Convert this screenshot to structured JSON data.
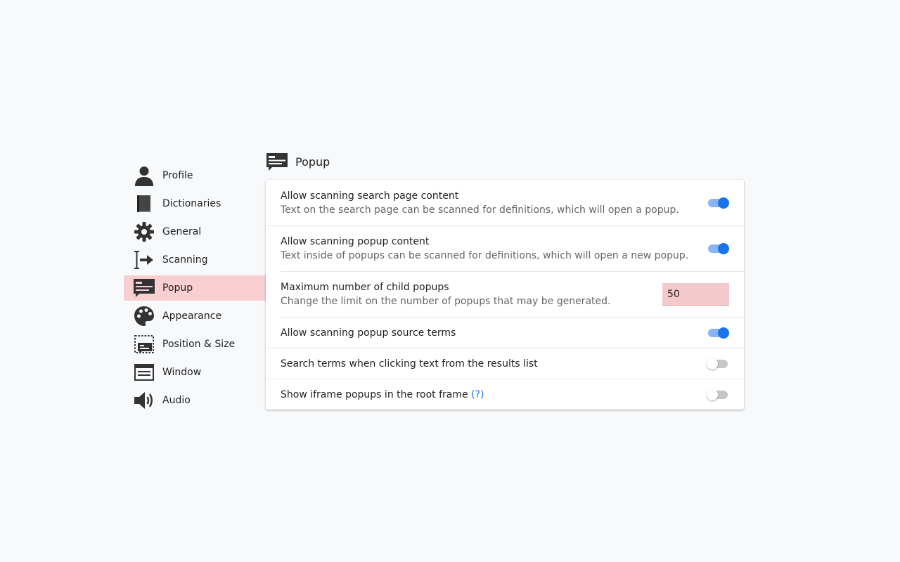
{
  "sidebar": {
    "items": [
      {
        "label": "Profile",
        "icon": "person-icon",
        "active": false
      },
      {
        "label": "Dictionaries",
        "icon": "book-icon",
        "active": false
      },
      {
        "label": "General",
        "icon": "gear-icon",
        "active": false
      },
      {
        "label": "Scanning",
        "icon": "text-cursor-arrow-icon",
        "active": false
      },
      {
        "label": "Popup",
        "icon": "popup-icon",
        "active": true
      },
      {
        "label": "Appearance",
        "icon": "palette-icon",
        "active": false
      },
      {
        "label": "Position & Size",
        "icon": "position-size-icon",
        "active": false
      },
      {
        "label": "Window",
        "icon": "window-icon",
        "active": false
      },
      {
        "label": "Audio",
        "icon": "speaker-icon",
        "active": false
      }
    ]
  },
  "section": {
    "title": "Popup",
    "icon": "popup-icon"
  },
  "settings": {
    "scan_search_page": {
      "title": "Allow scanning search page content",
      "description": "Text on the search page can be scanned for definitions, which will open a popup.",
      "enabled": true
    },
    "scan_popup_content": {
      "title": "Allow scanning popup content",
      "description": "Text inside of popups can be scanned for definitions, which will open a new popup.",
      "enabled": true
    },
    "max_child_popups": {
      "title": "Maximum number of child popups",
      "description": "Change the limit on the number of popups that may be generated.",
      "value": "50"
    },
    "scan_popup_source_terms": {
      "title": "Allow scanning popup source terms",
      "enabled": true
    },
    "search_on_click": {
      "title": "Search terms when clicking text from the results list",
      "enabled": false
    },
    "iframe_root_frame": {
      "title": "Show iframe popups in the root frame",
      "help": "(?)",
      "enabled": false
    }
  },
  "colors": {
    "accent": "#1a73e8",
    "toggle_track_on": "#8ab4f8",
    "active_nav_bg": "#f9cfd2",
    "invalid_input_bg": "#f4c9cc"
  }
}
